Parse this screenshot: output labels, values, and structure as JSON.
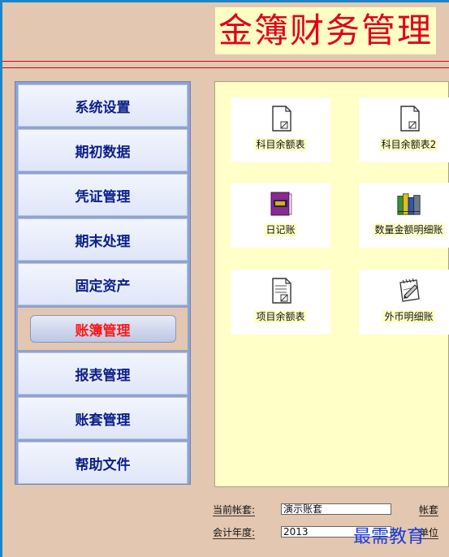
{
  "app": {
    "title": "金簿财务管理"
  },
  "menu": {
    "items": [
      {
        "label": "系统设置"
      },
      {
        "label": "期初数据"
      },
      {
        "label": "凭证管理"
      },
      {
        "label": "期末处理"
      },
      {
        "label": "固定资产"
      },
      {
        "label": "账簿管理",
        "active": true
      },
      {
        "label": "报表管理"
      },
      {
        "label": "账套管理"
      },
      {
        "label": "帮助文件"
      }
    ]
  },
  "reports": {
    "tiles": [
      {
        "label": "科目余额表",
        "icon": "document-icon"
      },
      {
        "label": "科目余额表2",
        "icon": "document-icon"
      },
      {
        "label": "日记账",
        "icon": "diary-book-icon"
      },
      {
        "label": "数量金额明细账",
        "icon": "books-icon"
      },
      {
        "label": "项目余额表",
        "icon": "lined-document-icon"
      },
      {
        "label": "外币明细账",
        "icon": "notepad-pen-icon"
      }
    ]
  },
  "status": {
    "current_account_label": "当前帐套:",
    "current_account_value": "演示账套",
    "fiscal_year_label": "会计年度:",
    "fiscal_year_value": "2013",
    "right_label_1": "帐套",
    "right_label_2": "单位"
  },
  "watermark": {
    "text": "最需教育"
  },
  "colors": {
    "background": "#e3c7b0",
    "title_red": "#e0001b",
    "menu_text": "#0b1f8a",
    "active_text": "#ff1a1a",
    "content_bg": "#ffffc8",
    "outer_blue": "#1a86c9"
  }
}
